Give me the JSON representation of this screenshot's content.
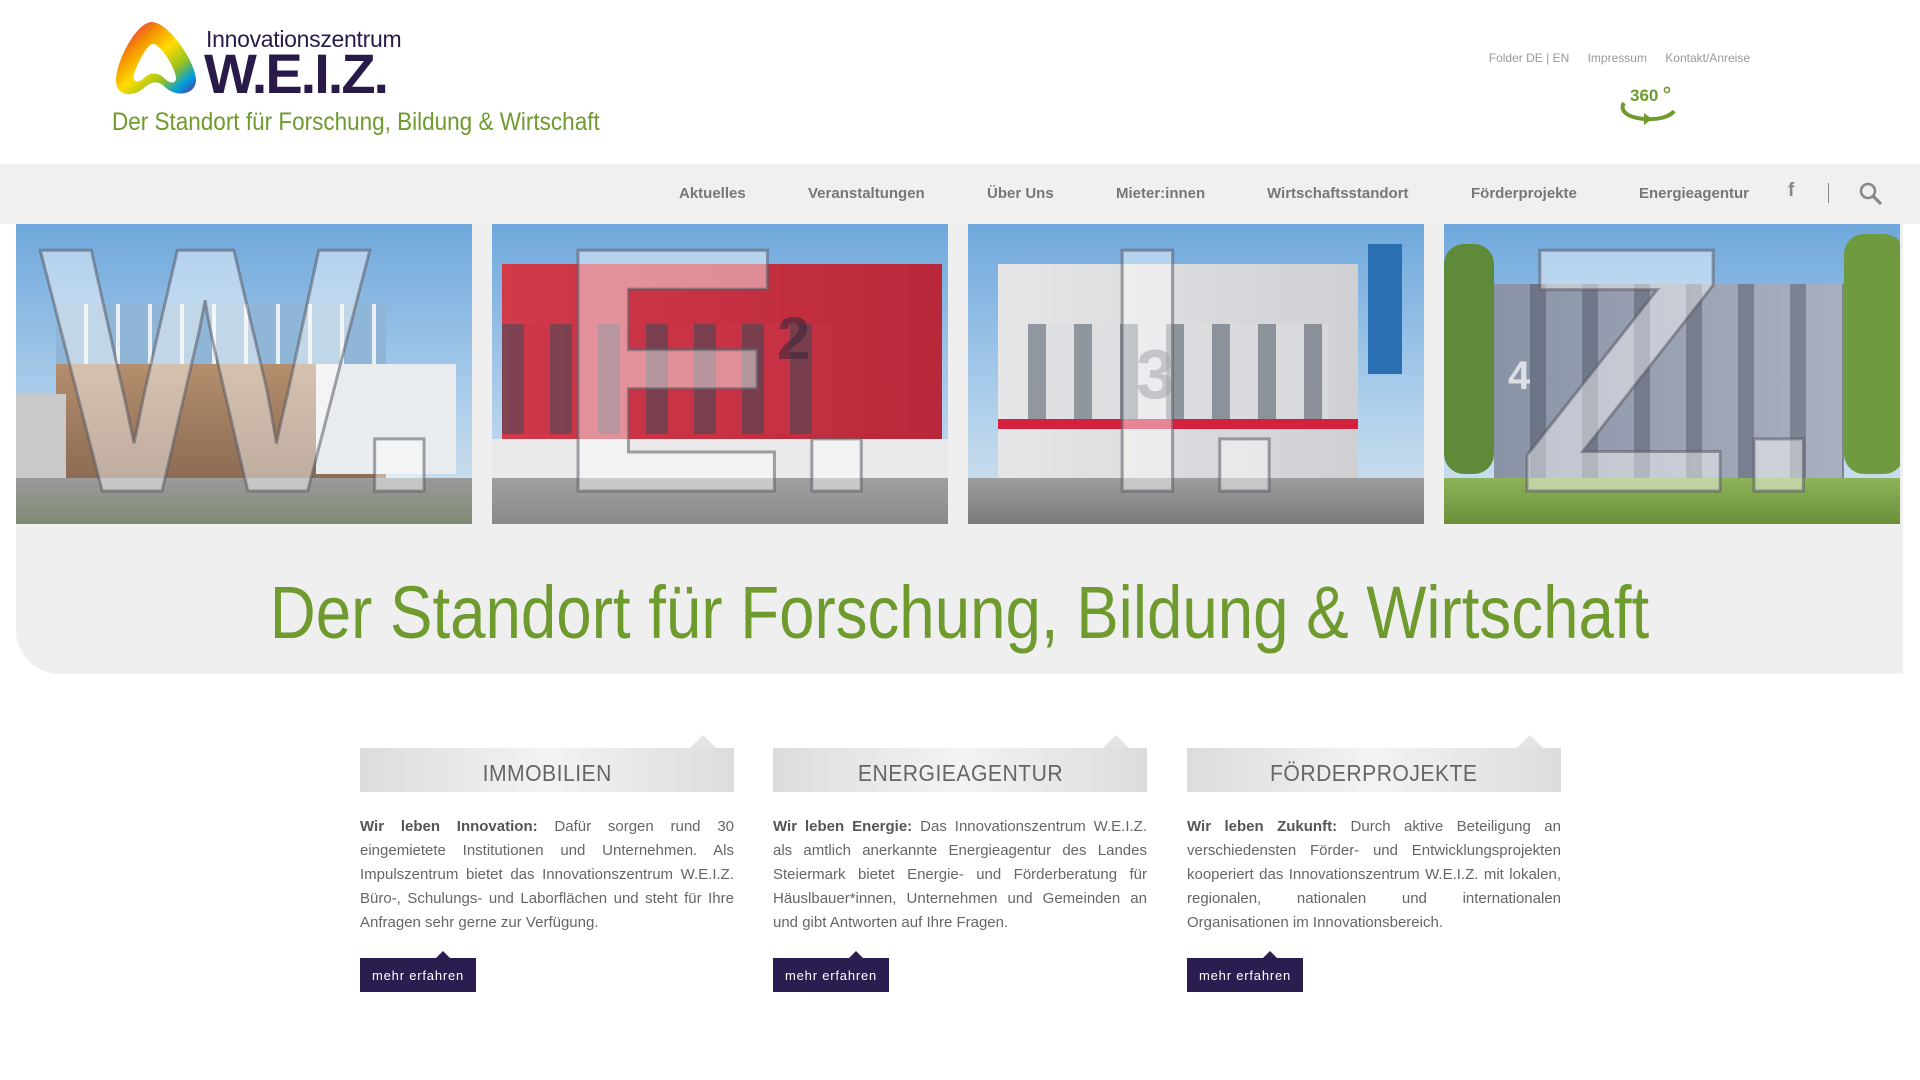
{
  "header": {
    "logo_small": "Innovationszentrum",
    "logo_big": "W.E.I.Z.",
    "tagline": "Der Standort für Forschung, Bildung & Wirtschaft",
    "meta_links": [
      "Folder DE | EN",
      "Impressum",
      "Kontakt/Anreise"
    ],
    "tour_label": "360°"
  },
  "nav": {
    "items": [
      "Aktuelles",
      "Veranstaltungen",
      "Über Uns",
      "Mieter:innen",
      "Wirtschaftsstandort",
      "Förderprojekte",
      "Energieagentur"
    ],
    "facebook": "f"
  },
  "hero": {
    "letters": [
      "W.",
      "E.",
      "I.",
      "Z."
    ],
    "building_numbers": [
      "",
      "2",
      "3",
      "4"
    ],
    "title": "Der Standort für Forschung, Bildung & Wirtschaft"
  },
  "columns": [
    {
      "title": "IMMOBILIEN",
      "lead": "Wir leben Innovation:",
      "text": " Dafür sorgen rund 30 eingemietete Institutionen und Unternehmen. Als Impulszentrum bietet das Innovationszentrum W.E.I.Z. Büro-, Schulungs- und Laborflächen und steht für Ihre Anfragen sehr gerne zur Verfügung.",
      "button": "mehr erfahren"
    },
    {
      "title": "ENERGIEAGENTUR",
      "lead": "Wir leben Energie:",
      "text": " Das Innovationszentrum W.E.I.Z. als amtlich anerkannte Energieagentur des Landes Steiermark bietet Energie- und Förderberatung für Häuslbauer*innen, Unternehmen und Gemeinden an und gibt Antworten auf Ihre Fragen.",
      "button": "mehr erfahren"
    },
    {
      "title": "FÖRDERPROJEKTE",
      "lead": "Wir leben Zukunft:",
      "text": " Durch aktive Beteiligung an verschiedensten Förder- und Entwicklungsprojekten kooperiert das Innovationszentrum W.E.I.Z. mit lokalen, regionalen, nationalen und internationalen Organisationen im Innovationsbereich.",
      "button": "mehr erfahren"
    }
  ],
  "colors": {
    "brand_green": "#6e9a2e",
    "brand_purple": "#2c1d50",
    "nav_bg": "#f0f0ef"
  }
}
